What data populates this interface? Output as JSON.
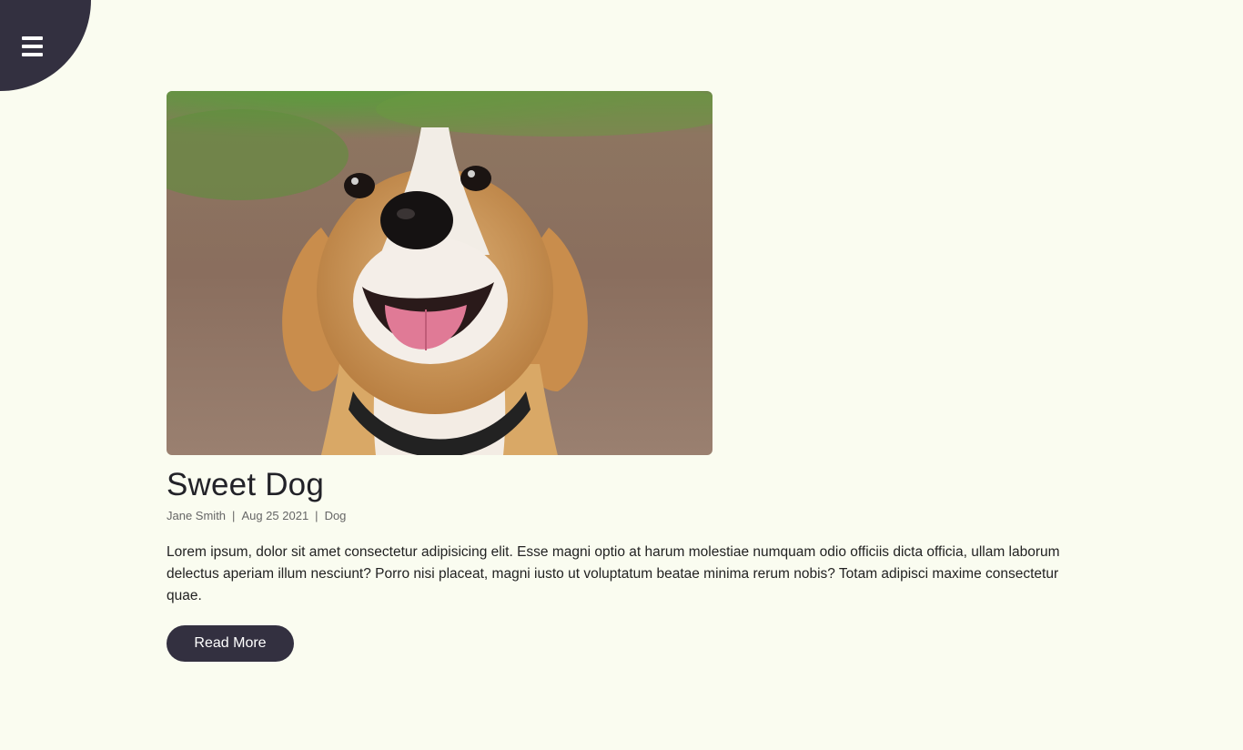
{
  "nav": {
    "menu_icon": "hamburger-menu-icon"
  },
  "post": {
    "image_subject": "beagle-photo",
    "title": "Sweet Dog",
    "author": "Jane Smith",
    "date": "Aug 25 2021",
    "category": "Dog",
    "separator": "|",
    "excerpt": "Lorem ipsum, dolor sit amet consectetur adipisicing elit. Esse magni optio at harum molestiae numquam odio officiis dicta officia, ullam laborum delectus aperiam illum nesciunt? Porro nisi placeat, magni iusto ut voluptatum beatae minima rerum nobis? Totam adipisci maxime consectetur quae.",
    "read_more_label": "Read More"
  },
  "colors": {
    "background": "#fafcf0",
    "accent_dark": "#333040",
    "text": "#222222",
    "meta_text": "#666666"
  }
}
